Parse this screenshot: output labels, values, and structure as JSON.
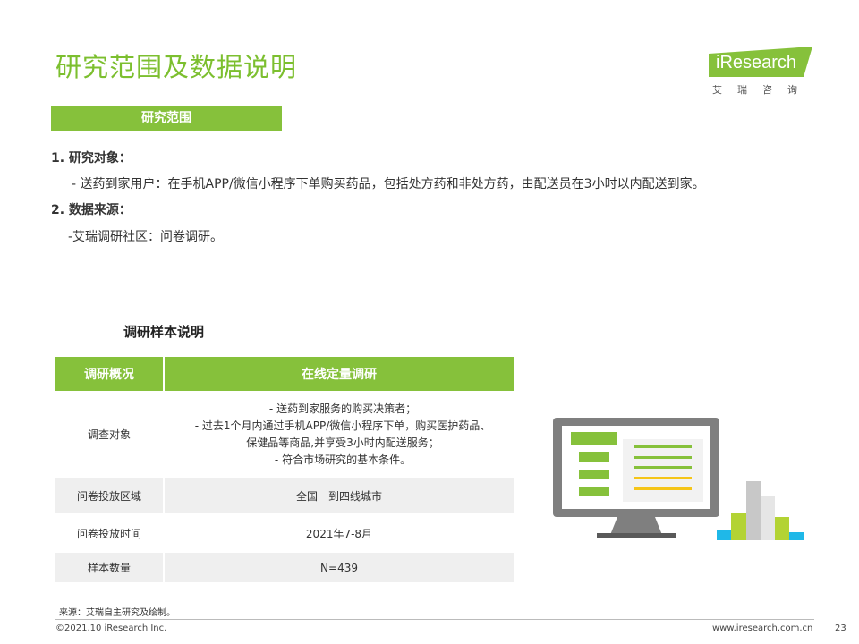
{
  "header": {
    "title": "研究范围及数据说明",
    "logo_text": "iResearch",
    "logo_sub": "艾瑞咨询"
  },
  "scope": {
    "tab_label": "研究范围",
    "item1_title": "1.  研究对象：",
    "item1_text": "- 送药到家用户：在手机APP/微信小程序下单购买药品，包括处方药和非处方药，由配送员在3小时以内配送到家。",
    "item2_title": "2. 数据来源：",
    "item2_text": "-艾瑞调研社区：问卷调研。"
  },
  "sample_table": {
    "caption": "调研样本说明",
    "header_left": "调研概况",
    "header_right": "在线定量调研",
    "rows": [
      {
        "label": "调查对象",
        "lines": [
          "- 送药到家服务的购买决策者；",
          "- 过去1个月内通过手机APP/微信小程序下单，购买医护药品、",
          "保健品等商品,并享受3小时内配送服务；",
          "- 符合市场研究的基本条件。"
        ]
      },
      {
        "label": "问卷投放区域",
        "value": "全国一到四线城市"
      },
      {
        "label": "问卷投放时间",
        "value": "2021年7-8月"
      },
      {
        "label": "样本数量",
        "value": "N=439"
      }
    ]
  },
  "footer": {
    "source": "来源：艾瑞自主研究及绘制。",
    "copyright": "©2021.10 iResearch Inc.",
    "website": "www.iresearch.com.cn",
    "page_number": "23"
  },
  "colors": {
    "brand_green": "#86c13b",
    "title_green": "#7cbf2f",
    "row_grey": "#efefef",
    "monitor_grey": "#7f7f7f",
    "bar_cyan": "#1fb8e8",
    "bar_yellow": "#f5c518"
  },
  "icons": {
    "illustration": "monitor-with-bar-chart-icon"
  }
}
